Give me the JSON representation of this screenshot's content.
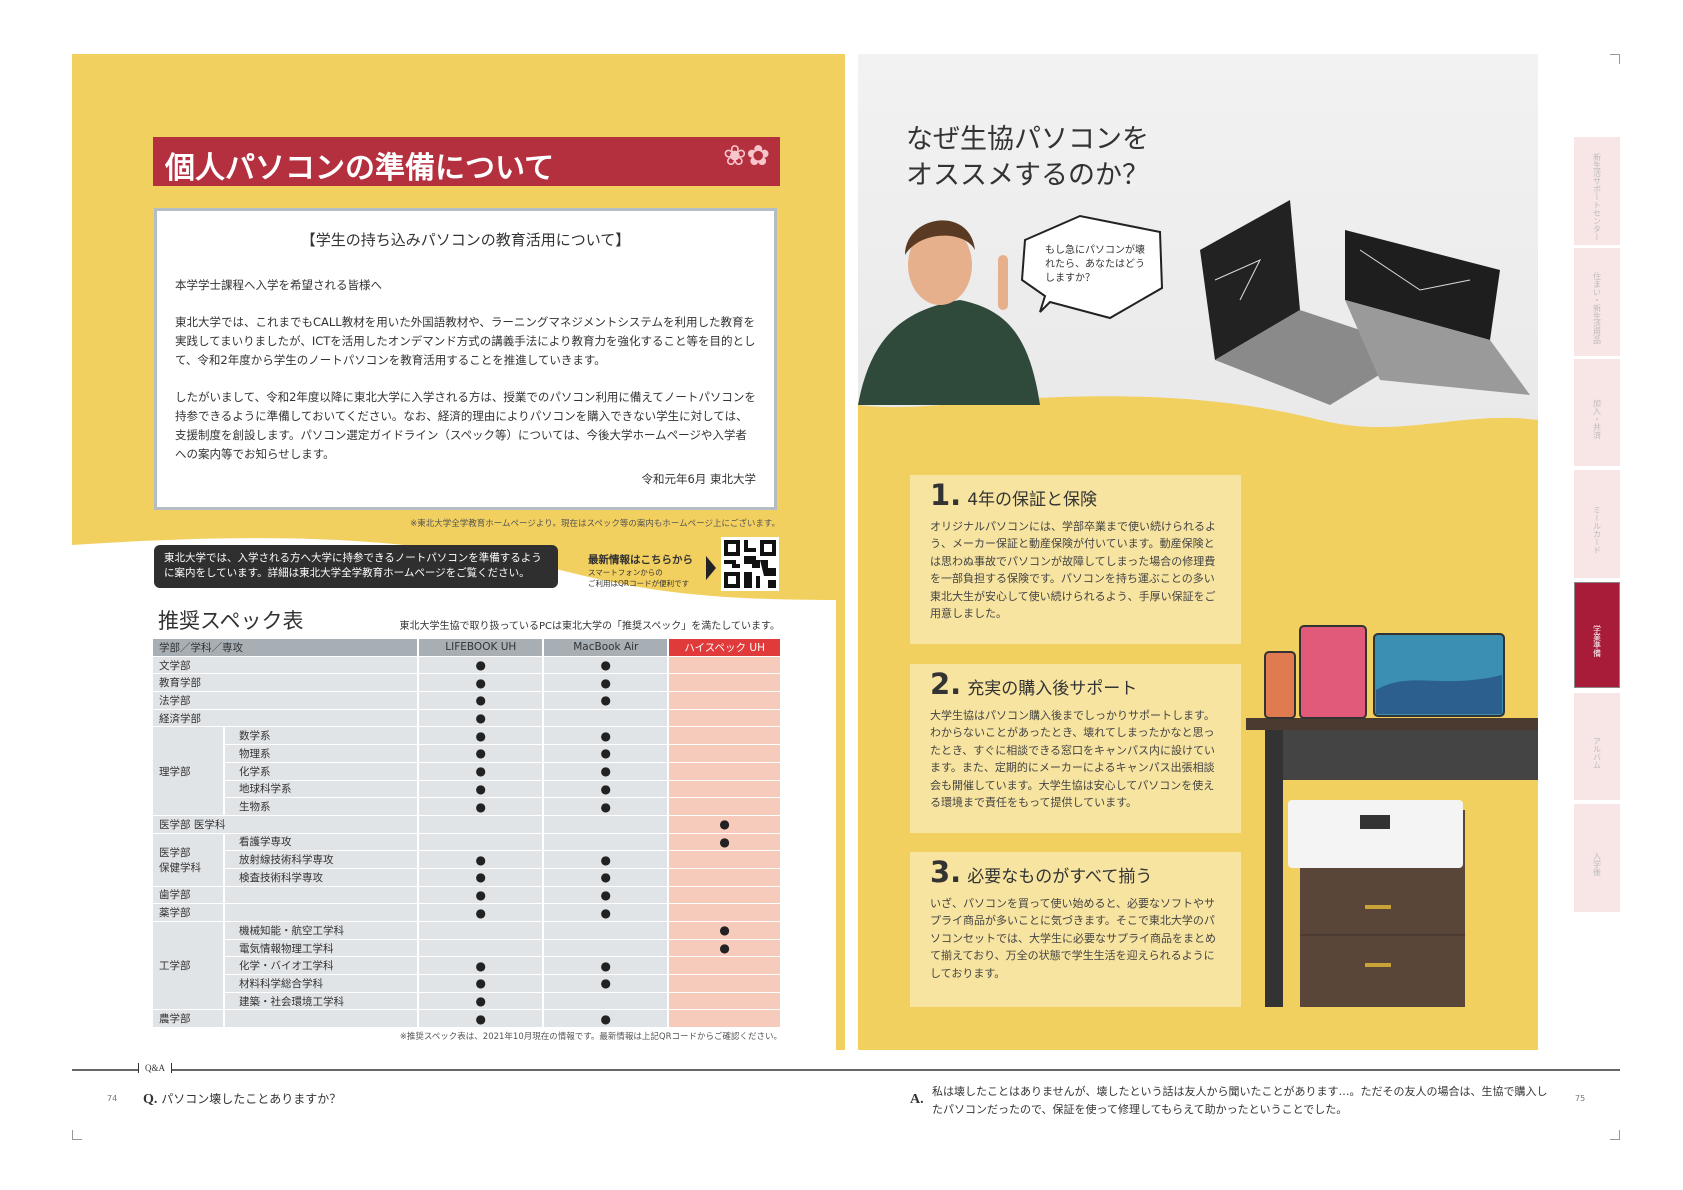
{
  "left_page": {
    "title": "個人パソコンの準備について",
    "notice": {
      "heading": "【学生の持ち込みパソコンの教育活用について】",
      "salutation": "本学学士課程へ入学を希望される皆様へ",
      "para1": "東北大学では、これまでもCALL教材を用いた外国語教材や、ラーニングマネジメントシステムを利用した教育を実践してまいりましたが、ICTを活用したオンデマンド方式の講義手法により教育力を強化すること等を目的として、令和2年度から学生のノートパソコンを教育活用することを推進していきます。",
      "para2": "したがいまして、令和2年度以降に東北大学に入学される方は、授業でのパソコン利用に備えてノートパソコンを持参できるように準備しておいてください。なお、経済的理由によりパソコンを購入できない学生に対しては、支援制度を創設します。パソコン選定ガイドライン（スペック等）については、今後大学ホームページや入学者への案内等でお知らせします。",
      "signature": "令和元年6月 東北大学"
    },
    "notice_footnote": "※東北大学全学教育ホームページより。現在はスペック等の案内もホームページ上にございます。",
    "dark_note": "東北大学では、入学される方へ大学に持参できるノートパソコンを準備するように案内をしています。詳細は東北大学全学教育ホームページをご覧ください。",
    "qr_title": "最新情報はこちらから",
    "qr_sub1": "スマートフォンからの",
    "qr_sub2": "ご利用はQRコードが便利です",
    "spec_title": "推奨スペック表",
    "spec_note": "東北大学生協で取り扱っているPCは東北大学の「推奨スペック」を満たしています。",
    "table": {
      "headers": [
        "学部／学科／専攻",
        "LIFEBOOK UH",
        "MacBook Air",
        "ハイスペック UH"
      ],
      "mark": "●",
      "groups": [
        {
          "name": "文学部",
          "span": true,
          "marks": [
            1,
            1,
            0
          ]
        },
        {
          "name": "教育学部",
          "span": true,
          "marks": [
            1,
            1,
            0
          ]
        },
        {
          "name": "法学部",
          "span": true,
          "marks": [
            1,
            1,
            0
          ]
        },
        {
          "name": "経済学部",
          "span": true,
          "marks": [
            1,
            0,
            0
          ]
        },
        {
          "name": "理学部",
          "subs": [
            {
              "name": "数学系",
              "marks": [
                1,
                1,
                0
              ]
            },
            {
              "name": "物理系",
              "marks": [
                1,
                1,
                0
              ]
            },
            {
              "name": "化学系",
              "marks": [
                1,
                1,
                0
              ]
            },
            {
              "name": "地球科学系",
              "marks": [
                1,
                1,
                0
              ]
            },
            {
              "name": "生物系",
              "marks": [
                1,
                1,
                0
              ]
            }
          ]
        },
        {
          "name": "医学部 医学科",
          "span": true,
          "marks": [
            0,
            0,
            1
          ]
        },
        {
          "name": "医学部\n保健学科",
          "subs": [
            {
              "name": "看護学専攻",
              "marks": [
                0,
                0,
                1
              ]
            },
            {
              "name": "放射線技術科学専攻",
              "marks": [
                1,
                1,
                0
              ]
            },
            {
              "name": "検査技術科学専攻",
              "marks": [
                1,
                1,
                0
              ]
            }
          ]
        },
        {
          "name": "歯学部",
          "marks": [
            1,
            1,
            0
          ]
        },
        {
          "name": "薬学部",
          "marks": [
            1,
            1,
            0
          ]
        },
        {
          "name": "工学部",
          "subs": [
            {
              "name": "機械知能・航空工学科",
              "marks": [
                0,
                0,
                1
              ]
            },
            {
              "name": "電気情報物理工学科",
              "marks": [
                0,
                0,
                1
              ]
            },
            {
              "name": "化学・バイオ工学科",
              "marks": [
                1,
                1,
                0
              ]
            },
            {
              "name": "材料科学総合学科",
              "marks": [
                1,
                1,
                0
              ]
            },
            {
              "name": "建築・社会環境工学科",
              "marks": [
                1,
                0,
                0
              ]
            }
          ]
        },
        {
          "name": "農学部",
          "marks": [
            1,
            1,
            0
          ]
        }
      ]
    },
    "table_footnote": "※推奨スペック表は、2021年10月現在の情報です。最新情報は上記QRコードからご確認ください。",
    "page_number": "74"
  },
  "right_page": {
    "heading_line1": "なぜ生協パソコンを",
    "heading_line2": "オススメするのか？",
    "speech": "もし急にパソコンが壊れたら、あなたはどうしますか？",
    "cards": [
      {
        "num": "1.",
        "title": "4年の保証と保険",
        "body": "オリジナルパソコンには、学部卒業まで使い続けられるよう、メーカー保証と動産保険が付いています。動産保険とは思わぬ事故でパソコンが故障してしまった場合の修理費を一部負担する保険です。パソコンを持ち運ぶことの多い東北大生が安心して使い続けられるよう、手厚い保証をご用意しました。"
      },
      {
        "num": "2.",
        "title": "充実の購入後サポート",
        "body": "大学生協はパソコン購入後までしっかりサポートします。わからないことがあったとき、壊れてしまったかなと思ったとき、すぐに相談できる窓口をキャンパス内に設けています。また、定期的にメーカーによるキャンパス出張相談会も開催しています。大学生協は安心してパソコンを使える環境まで責任をもって提供しています。"
      },
      {
        "num": "3.",
        "title": "必要なものがすべて揃う",
        "body": "いざ、パソコンを買って使い始めると、必要なソフトやサプライ商品が多いことに気づきます。そこで東北大学のパソコンセットでは、大学生に必要なサプライ商品をまとめて揃えており、万全の状態で学生生活を迎えられるようにしております。"
      }
    ],
    "page_number": "75"
  },
  "side_tabs": [
    {
      "label": "新生活サポートセンター",
      "active": false
    },
    {
      "label": "住まい・新生活用品",
      "active": false
    },
    {
      "label": "加入・共済",
      "active": false
    },
    {
      "label": "ミールカード",
      "active": false
    },
    {
      "label": "学業準備",
      "active": true
    },
    {
      "label": "アルバム",
      "active": false
    },
    {
      "label": "入学後",
      "active": false
    }
  ],
  "qa": {
    "label": "Q&A",
    "q_mark": "Q.",
    "question": "パソコン壊したことありますか？",
    "a_mark": "A.",
    "answer": "私は壊したことはありませんが、壊したという話は友人から聞いたことがあります…。ただその友人の場合は、生協で購入したパソコンだったので、保証を使って修理してもらえて助かったということでした。"
  },
  "colors": {
    "yellow": "#f2d060",
    "card": "#f7e4a0",
    "banner_red": "#b5303f",
    "tab_active": "#a81c3a",
    "high_spec": "#e03a3a"
  }
}
